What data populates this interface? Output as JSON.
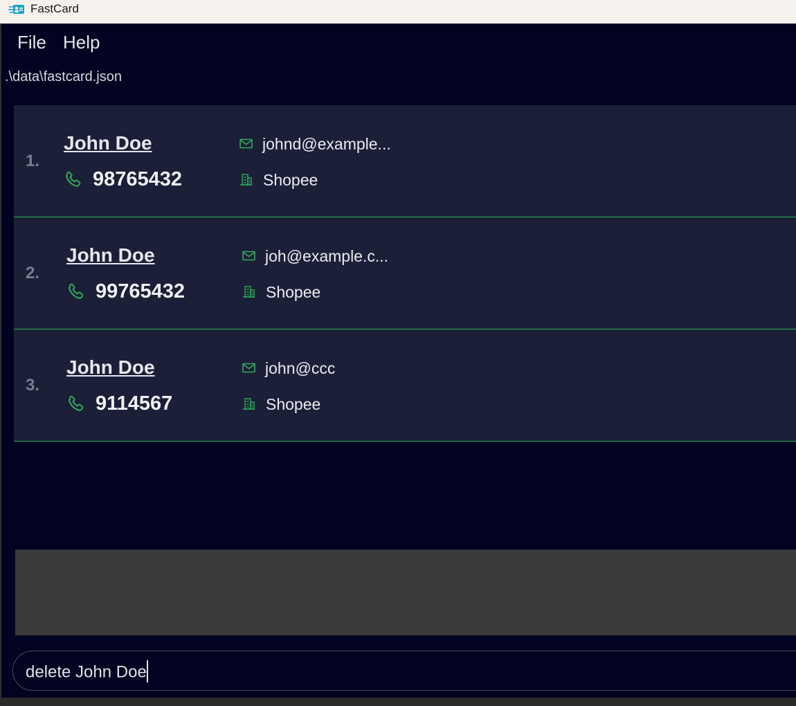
{
  "window": {
    "title": "FastCard"
  },
  "menu": {
    "file": "File",
    "help": "Help"
  },
  "status": {
    "filepath": ".\\data\\fastcard.json"
  },
  "contacts": [
    {
      "index": "1.",
      "name": "John Doe",
      "phone": "98765432",
      "email": "johnd@example...",
      "company": "Shopee"
    },
    {
      "index": "2.",
      "name": "John Doe",
      "phone": "99765432",
      "email": "joh@example.c...",
      "company": "Shopee"
    },
    {
      "index": "3.",
      "name": "John Doe",
      "phone": "9114567",
      "email": "john@ccc",
      "company": "Shopee"
    }
  ],
  "result": {
    "text": ""
  },
  "command": {
    "value": "delete John Doe"
  },
  "icons": {
    "phone": "phone-icon",
    "email": "mail-icon",
    "company": "building-icon"
  },
  "colors": {
    "background": "#010320",
    "card": "#1b1f38",
    "accent": "#2fae5a",
    "result_box": "#3a3a3a"
  }
}
